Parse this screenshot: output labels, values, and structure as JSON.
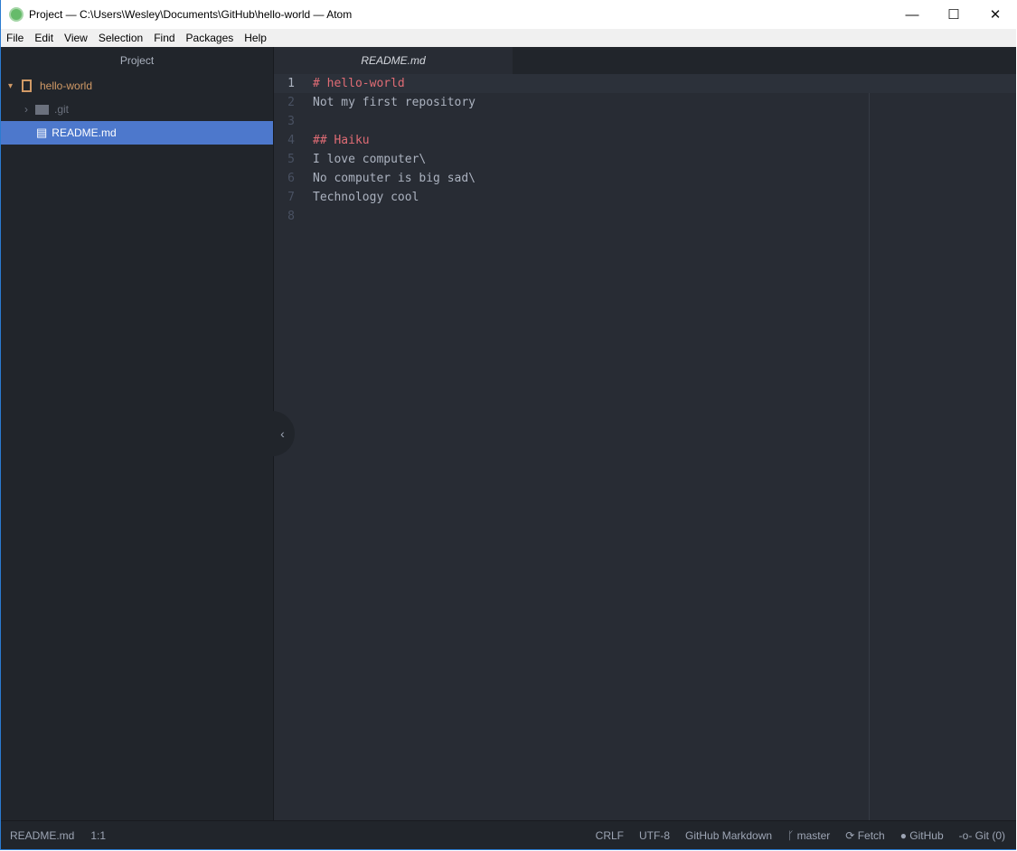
{
  "window": {
    "title": "Project — C:\\Users\\Wesley\\Documents\\GitHub\\hello-world — Atom",
    "minimize": "—",
    "maximize": "☐",
    "close": "✕"
  },
  "menu": [
    "File",
    "Edit",
    "View",
    "Selection",
    "Find",
    "Packages",
    "Help"
  ],
  "sidebar": {
    "title": "Project",
    "root": "hello-world",
    "items": [
      {
        "label": ".git",
        "type": "folder"
      },
      {
        "label": "README.md",
        "type": "file",
        "selected": true
      }
    ]
  },
  "tabs": [
    {
      "label": "README.md",
      "active": true
    }
  ],
  "editor": {
    "lines": [
      {
        "n": "1",
        "text": "# hello-world",
        "heading": true
      },
      {
        "n": "2",
        "text": "Not my first repository"
      },
      {
        "n": "3",
        "text": ""
      },
      {
        "n": "4",
        "text": "## Haiku",
        "heading": true
      },
      {
        "n": "5",
        "text": "I love computer\\"
      },
      {
        "n": "6",
        "text": "No computer is big sad\\"
      },
      {
        "n": "7",
        "text": "Technology cool"
      },
      {
        "n": "8",
        "text": ""
      }
    ]
  },
  "status": {
    "file": "README.md",
    "cursor": "1:1",
    "line_ending": "CRLF",
    "encoding": "UTF-8",
    "grammar": "GitHub Markdown",
    "branch": "master",
    "fetch": "Fetch",
    "github": "GitHub",
    "git": "Git (0)"
  },
  "colors": {
    "accent": "#4d78cc",
    "heading": "#e06c75",
    "root": "#d19a66"
  }
}
